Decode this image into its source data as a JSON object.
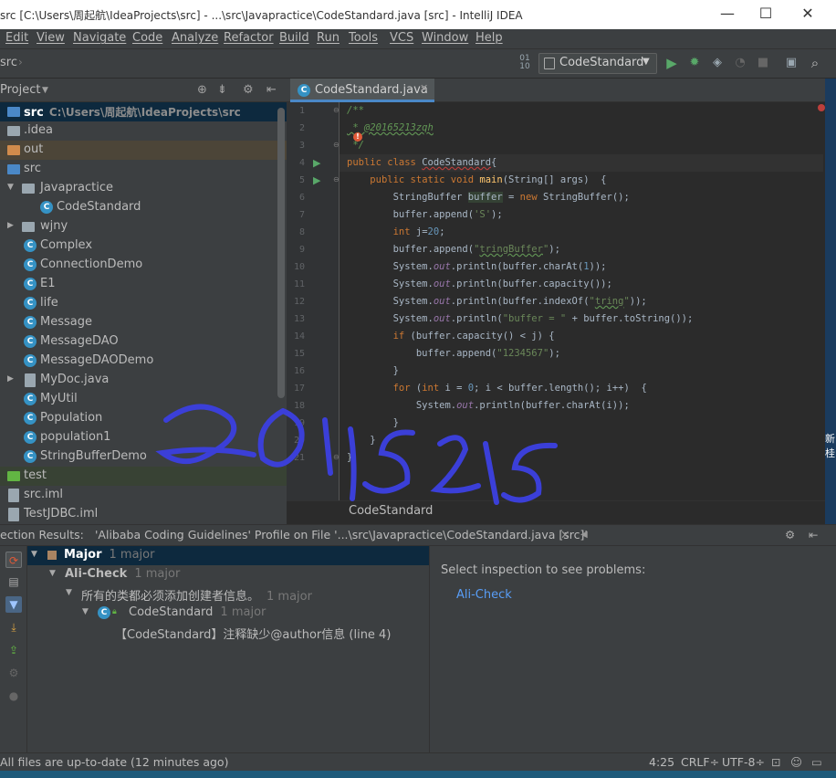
{
  "window": {
    "title": "src [C:\\Users\\周起航\\IdeaProjects\\src] - ...\\src\\Javapractice\\CodeStandard.java [src] - IntelliJ IDEA",
    "minimize": "—",
    "maximize": "☐",
    "close": "✕"
  },
  "menu": [
    "Edit",
    "View",
    "Navigate",
    "Code",
    "Analyze",
    "Refactor",
    "Build",
    "Run",
    "Tools",
    "VCS",
    "Window",
    "Help"
  ],
  "navbar": {
    "breadcrumb": "src",
    "run_config": "CodeStandard"
  },
  "project": {
    "header": "Project",
    "items": [
      {
        "label": "src",
        "path": "C:\\Users\\周起航\\IdeaProjects\\src"
      },
      {
        "label": ".idea"
      },
      {
        "label": "out"
      },
      {
        "label": "src"
      },
      {
        "label": "Javapractice"
      },
      {
        "label": "CodeStandard"
      },
      {
        "label": "wjny"
      },
      {
        "label": "Complex"
      },
      {
        "label": "ConnectionDemo"
      },
      {
        "label": "E1"
      },
      {
        "label": "life"
      },
      {
        "label": "Message"
      },
      {
        "label": "MessageDAO"
      },
      {
        "label": "MessageDAODemo"
      },
      {
        "label": "MyDoc.java"
      },
      {
        "label": "MyUtil"
      },
      {
        "label": "Population"
      },
      {
        "label": "population1"
      },
      {
        "label": "StringBufferDemo"
      },
      {
        "label": "test"
      },
      {
        "label": "src.iml"
      },
      {
        "label": "TestJDBC.iml"
      }
    ]
  },
  "editor": {
    "tab": "CodeStandard.java",
    "breadcrumb": "CodeStandard",
    "lines": [
      "/**",
      " * @20165213zqh",
      " */",
      "public class CodeStandard{",
      "    public static void main(String[] args)  {",
      "        StringBuffer buffer = new StringBuffer();",
      "        buffer.append('S');",
      "        int j=20;",
      "        buffer.append(\"tringBuffer\");",
      "        System.out.println(buffer.charAt(1));",
      "        System.out.println(buffer.capacity());",
      "        System.out.println(buffer.indexOf(\"tring\"));",
      "        System.out.println(\"buffer = \" + buffer.toString());",
      "        if (buffer.capacity() < j) {",
      "            buffer.append(\"1234567\");",
      "        }",
      "        for (int i = 0; i < buffer.length(); i++)  {",
      "            System.out.println(buffer.charAt(i));",
      "        }",
      "    }",
      "}"
    ],
    "line_numbers": [
      "1",
      "2",
      "3",
      "4",
      "5",
      "6",
      "7",
      "8",
      "9",
      "10",
      "11",
      "12",
      "13",
      "14",
      "15",
      "16",
      "17",
      "18",
      "19",
      "20",
      "21"
    ]
  },
  "inspection": {
    "header_prefix": "ection Results:",
    "profile": "'Alibaba Coding Guidelines' Profile on File '...\\src\\Javapractice\\CodeStandard.java [src]'",
    "tree": [
      {
        "label": "Major",
        "count": "1 major"
      },
      {
        "label": "Ali-Check",
        "count": "1 major"
      },
      {
        "label": "所有的类都必须添加创建者信息。",
        "count": "1 major"
      },
      {
        "label": "CodeStandard",
        "count": "1 major"
      },
      {
        "label": "【CodeStandard】注释缺少@author信息 (line 4)",
        "count": ""
      }
    ],
    "right_text": "Select inspection to see problems:",
    "right_link": "Ali-Check"
  },
  "status": {
    "message": "All files are up-to-date (12 minutes ago)",
    "position": "4:25",
    "line_sep": "CRLF÷",
    "encoding": "UTF-8÷"
  },
  "desktop_text": [
    "新",
    "桂"
  ],
  "handwriting_text": "20165215",
  "colors": {
    "accent": "#4a88c7",
    "class_icon": "#3592c4",
    "run_green": "#59a869",
    "handwriting": "#3b3fd8"
  }
}
